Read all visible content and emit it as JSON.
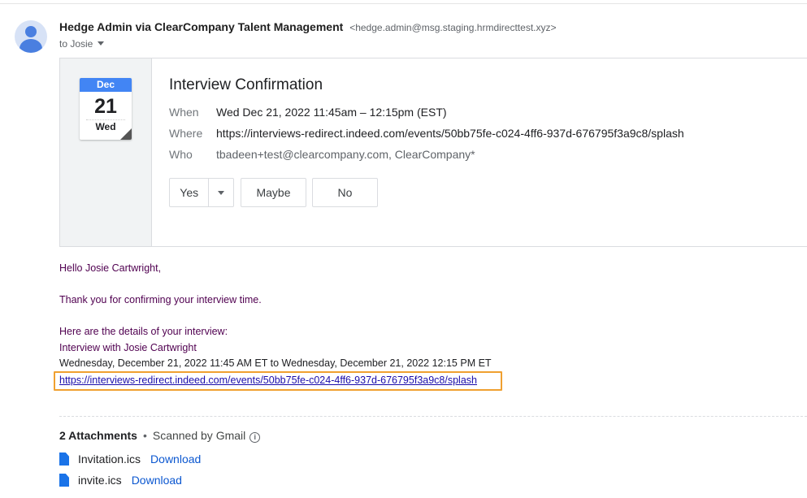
{
  "email": {
    "sender_name": "Hedge Admin via ClearCompany Talent Management",
    "sender_address": "<hedge.admin@msg.staging.hrmdirecttest.xyz>",
    "to_line": "to Josie"
  },
  "invite": {
    "calendar_month": "Dec",
    "calendar_day": "21",
    "calendar_weekday": "Wed",
    "title": "Interview Confirmation",
    "when_label": "When",
    "when_value": "Wed Dec 21, 2022 11:45am – 12:15pm (EST)",
    "where_label": "Where",
    "where_value": "https://interviews-redirect.indeed.com/events/50bb75fe-c024-4ff6-937d-676795f3a9c8/splash",
    "who_label": "Who",
    "who_value": "tbadeen+test@clearcompany.com, ClearCompany*",
    "rsvp_yes": "Yes",
    "rsvp_maybe": "Maybe",
    "rsvp_no": "No"
  },
  "message": {
    "greeting": "Hello Josie Cartwright,",
    "thanks": "Thank you for confirming your interview time.",
    "details_intro": "Here are the details of your interview:",
    "interview_with": "Interview with Josie Cartwright",
    "datetime": "Wednesday, December 21, 2022 11:45 AM ET to Wednesday, December 21, 2022 12:15 PM ET",
    "link": "https://interviews-redirect.indeed.com/events/50bb75fe-c024-4ff6-937d-676795f3a9c8/splash"
  },
  "attachments": {
    "count_label": "2 Attachments",
    "separator": "•",
    "scanned_label": "Scanned by Gmail",
    "info_glyph": "i",
    "items": [
      {
        "filename": "Invitation.ics",
        "download_label": "Download"
      },
      {
        "filename": "invite.ics",
        "download_label": "Download"
      }
    ]
  },
  "colors": {
    "highlight_box": "#f0a030",
    "link": "#1a0dab",
    "body_text": "#500050",
    "calendar_accent": "#4285f4"
  },
  "icons": [
    "avatar-icon",
    "chevron-down-icon",
    "calendar-icon",
    "info-icon",
    "file-icon"
  ]
}
